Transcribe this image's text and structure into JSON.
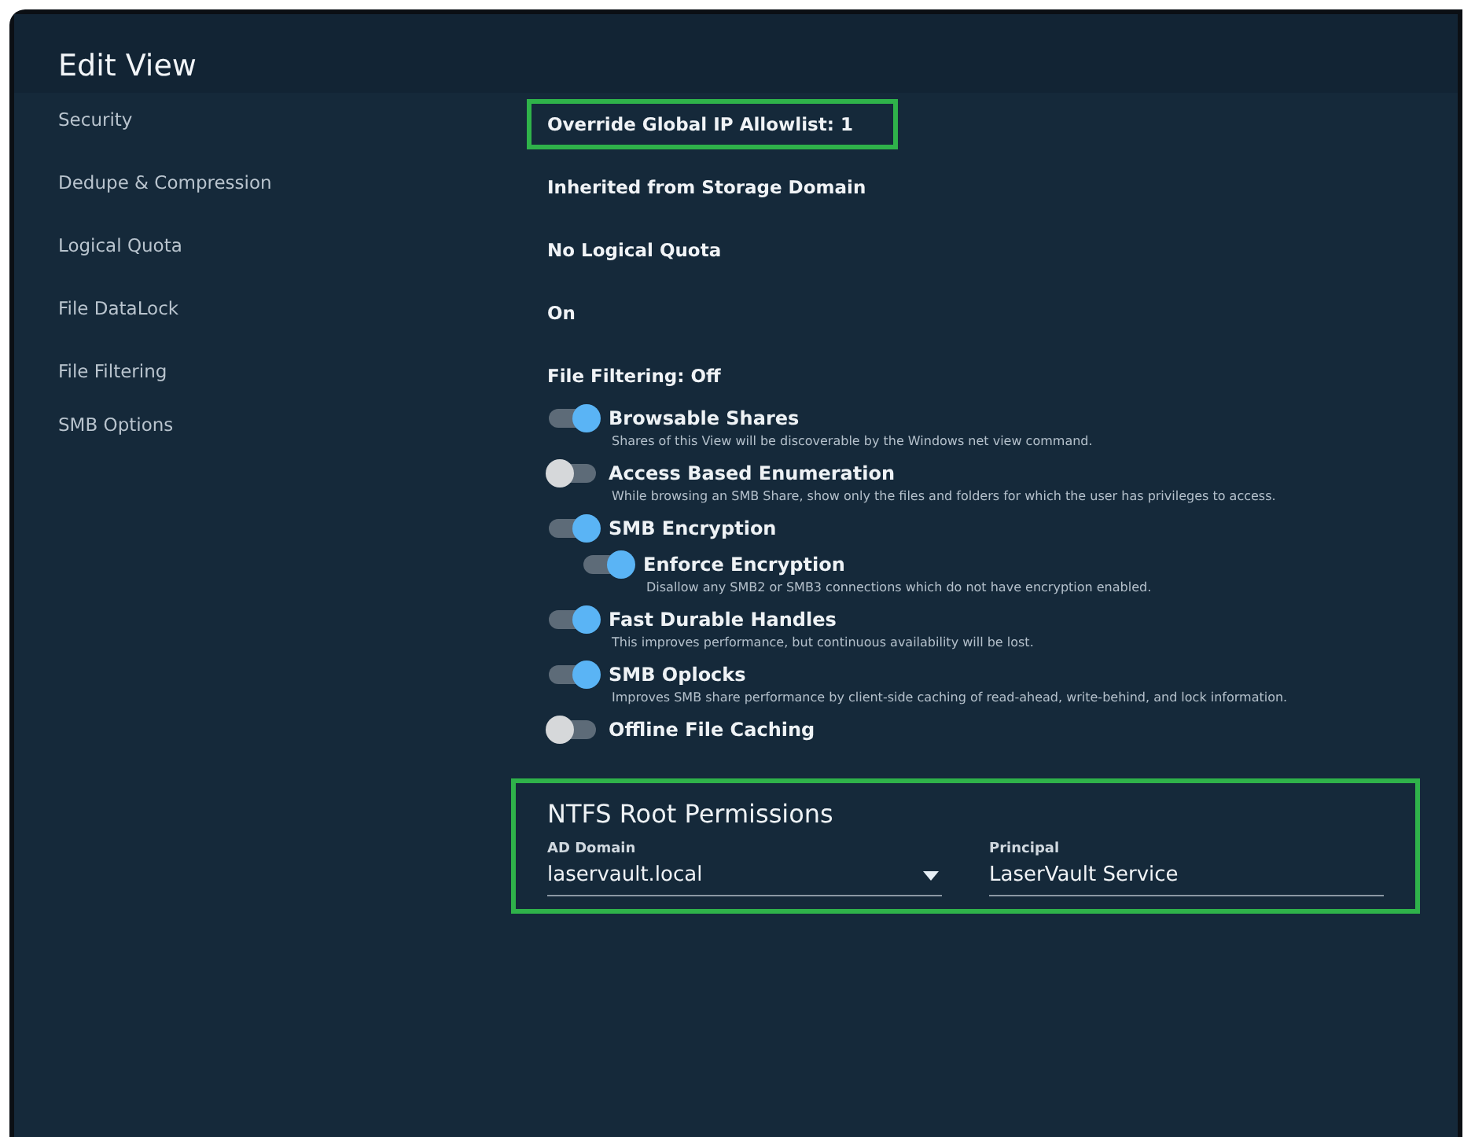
{
  "title": "Edit View",
  "settings": [
    {
      "label": "Security",
      "value": "Override Global IP Allowlist: 1",
      "highlighted": true
    },
    {
      "label": "Dedupe & Compression",
      "value": "Inherited from Storage Domain",
      "highlighted": false
    },
    {
      "label": "Logical Quota",
      "value": "No Logical Quota",
      "highlighted": false
    },
    {
      "label": "File DataLock",
      "value": "On",
      "highlighted": false
    },
    {
      "label": "File Filtering",
      "value": "File Filtering: Off",
      "highlighted": false
    }
  ],
  "smb_options": {
    "label": "SMB Options",
    "items": [
      {
        "label": "Browsable Shares",
        "description": "Shares of this View will be discoverable by the Windows net view command.",
        "on": true
      },
      {
        "label": "Access Based Enumeration",
        "description": "While browsing an SMB Share, show only the files and folders for which the user has privileges to access.",
        "on": false
      },
      {
        "label": "SMB Encryption",
        "on": true,
        "children": [
          {
            "label": "Enforce Encryption",
            "description": "Disallow any SMB2 or SMB3 connections which do not have encryption enabled.",
            "on": true
          }
        ]
      },
      {
        "label": "Fast Durable Handles",
        "description": "This improves performance, but continuous availability will be lost.",
        "on": true
      },
      {
        "label": "SMB Oplocks",
        "description": "Improves SMB share performance by client-side caching of read-ahead, write-behind, and lock information.",
        "on": true
      },
      {
        "label": "Offline File Caching",
        "on": false
      }
    ]
  },
  "ntfs": {
    "title": "NTFS Root Permissions",
    "highlighted": true,
    "fields": [
      {
        "kind": "select",
        "label": "AD Domain",
        "value": "laservault.local"
      },
      {
        "kind": "text",
        "label": "Principal",
        "value": "LaserVault Service"
      }
    ]
  }
}
